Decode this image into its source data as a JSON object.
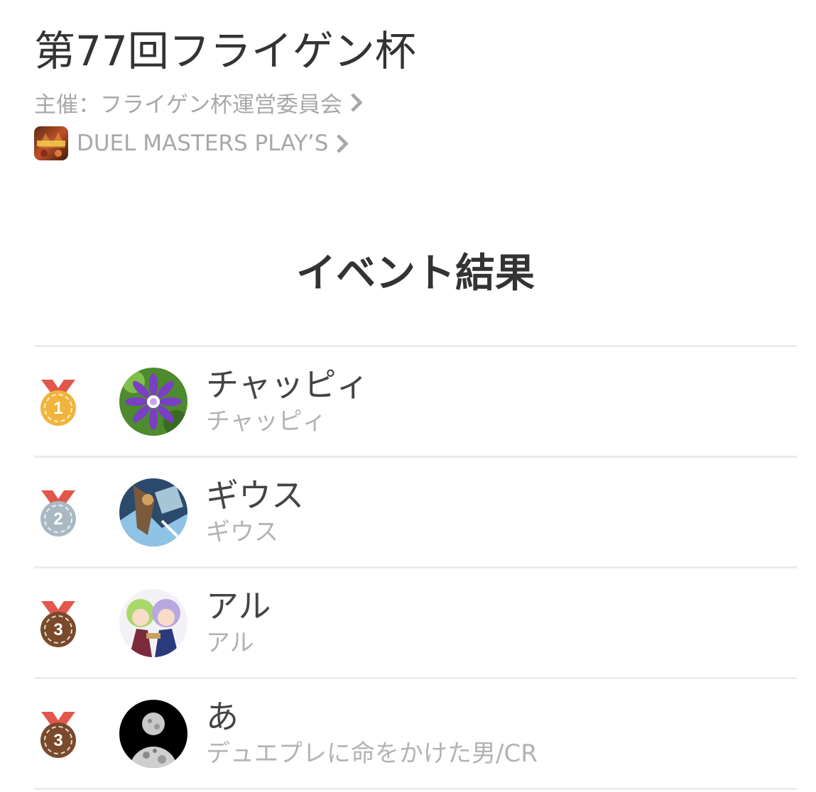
{
  "event": {
    "title": "第77回フライゲン杯",
    "organizer": "主催：フライゲン杯運営委員会",
    "game": "DUEL MASTERS PLAY’S"
  },
  "section_title": "イベント結果",
  "results": [
    {
      "rank": "1",
      "medal": "gold-medal-icon",
      "name": "チャッピィ",
      "sub": "チャッピィ"
    },
    {
      "rank": "2",
      "medal": "silver-medal-icon",
      "name": "ギウス",
      "sub": "ギウス"
    },
    {
      "rank": "3",
      "medal": "bronze-medal-icon",
      "name": "アル",
      "sub": "アル"
    },
    {
      "rank": "3",
      "medal": "bronze-medal-icon",
      "name": "あ",
      "sub": "デュエプレに命をかけた男/CR"
    }
  ],
  "colors": {
    "gold": "#F0B43C",
    "silver": "#A9B9C3",
    "bronze": "#7A4A2A",
    "ribbon": "#E2574C"
  }
}
